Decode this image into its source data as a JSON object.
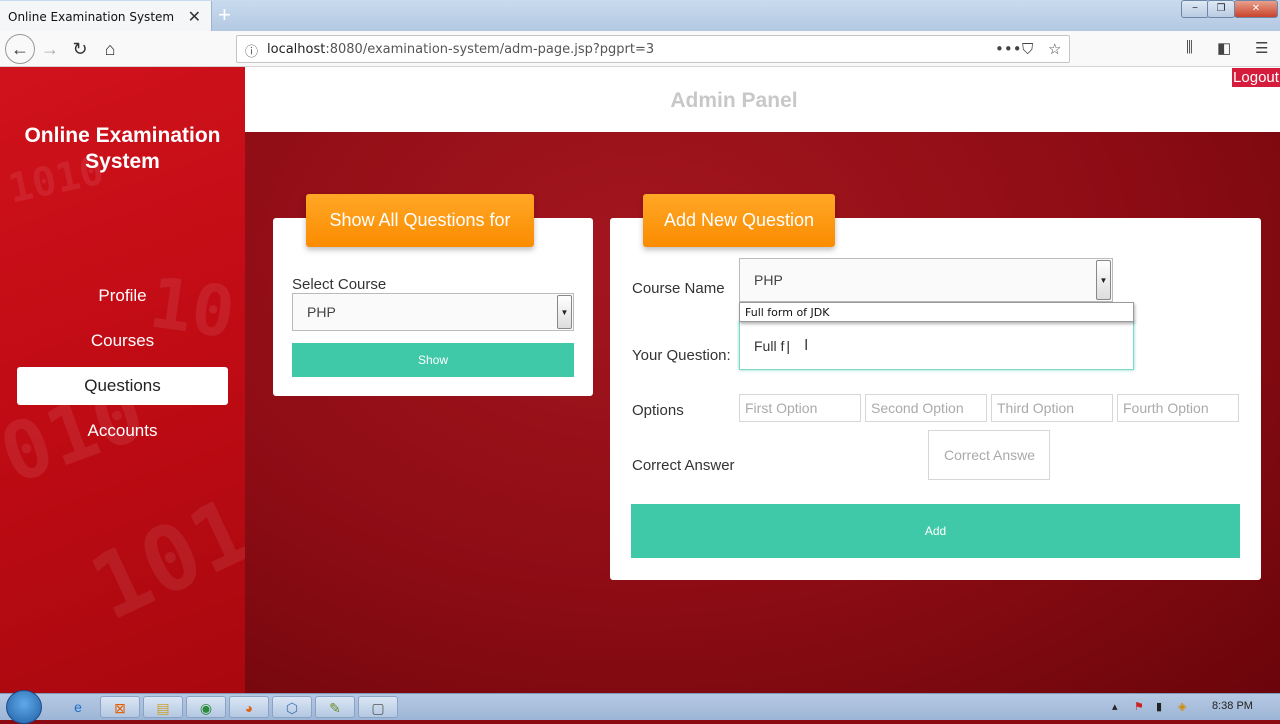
{
  "browser": {
    "tab_title": "Online Examination System",
    "tab_close": "✕",
    "new_tab": "+",
    "url_host": "localhost",
    "url_rest": ":8080/examination-system/adm-page.jsp?pgprt=3",
    "window_controls": [
      "−",
      "❐",
      "✕"
    ]
  },
  "sidebar": {
    "brand": "Online Examination System",
    "items": [
      {
        "label": "Profile",
        "active": false
      },
      {
        "label": "Courses",
        "active": false
      },
      {
        "label": "Questions",
        "active": true
      },
      {
        "label": "Accounts",
        "active": false
      }
    ]
  },
  "header": {
    "title": "Admin Panel",
    "logout": "Logout"
  },
  "show_card": {
    "tag": "Show All Questions for",
    "select_label": "Select Course",
    "selected_course": "PHP",
    "show_button": "Show"
  },
  "add_card": {
    "tag": "Add New Question",
    "course_label": "Course Name",
    "course_value": "PHP",
    "question_label": "Your Question:",
    "question_value": "Full f",
    "autocomplete_suggestion": "Full form of JDK",
    "options_label": "Options",
    "option_placeholders": [
      "First Option",
      "Second Option",
      "Third Option",
      "Fourth Option"
    ],
    "correct_label": "Correct Answer",
    "correct_placeholder": "Correct Answe",
    "add_button": "Add"
  },
  "taskbar": {
    "clock": "8:38 PM"
  }
}
